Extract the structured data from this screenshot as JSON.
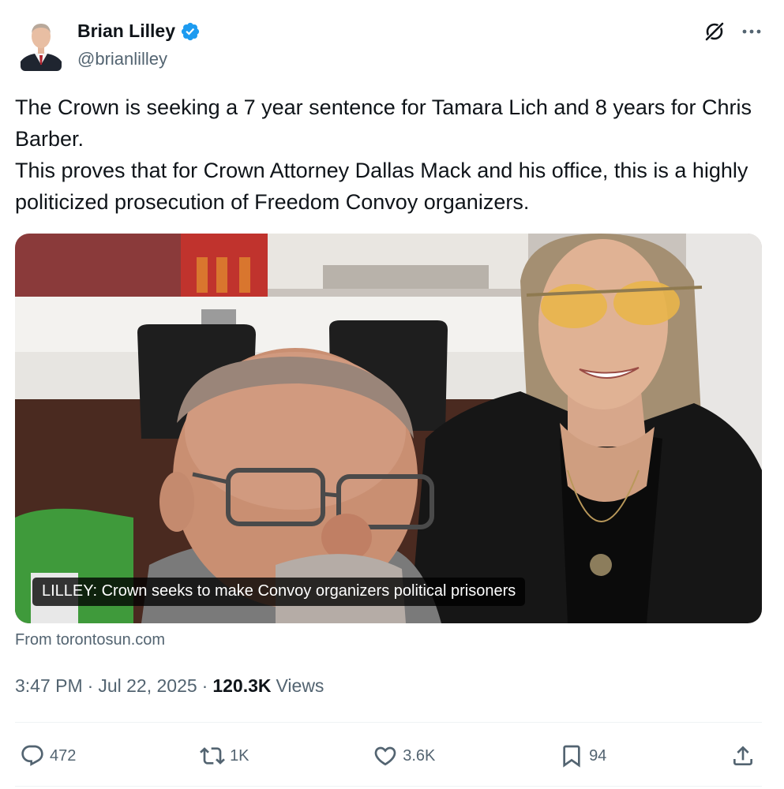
{
  "author": {
    "name": "Brian Lilley",
    "handle": "@brianlilley",
    "verified": true,
    "verified_color": "#1d9bf0"
  },
  "tweet": {
    "text": "The Crown is seeking a 7 year sentence for Tamara Lich and 8 years for Chris Barber.\nThis proves that for Crown Attorney Dallas Mack and his office, this is a highly politicized prosecution of Freedom Convoy organizers."
  },
  "link_card": {
    "caption": "LILLEY: Crown seeks to make Convoy organizers political prisoners",
    "source": "From torontosun.com"
  },
  "meta": {
    "time": "3:47 PM",
    "separator": "·",
    "date": "Jul 22, 2025",
    "separator2": "·",
    "views_count": "120.3K",
    "views_label": "Views"
  },
  "actions": {
    "replies": "472",
    "reposts": "1K",
    "likes": "3.6K",
    "bookmarks": "94"
  },
  "icons": {
    "top": [
      "grok-icon",
      "more-icon"
    ],
    "actions": [
      "reply-icon",
      "repost-icon",
      "like-icon",
      "bookmark-icon",
      "share-icon"
    ]
  },
  "colors": {
    "text_primary": "#0f1419",
    "text_secondary": "#536471",
    "divider": "#eff3f4"
  }
}
